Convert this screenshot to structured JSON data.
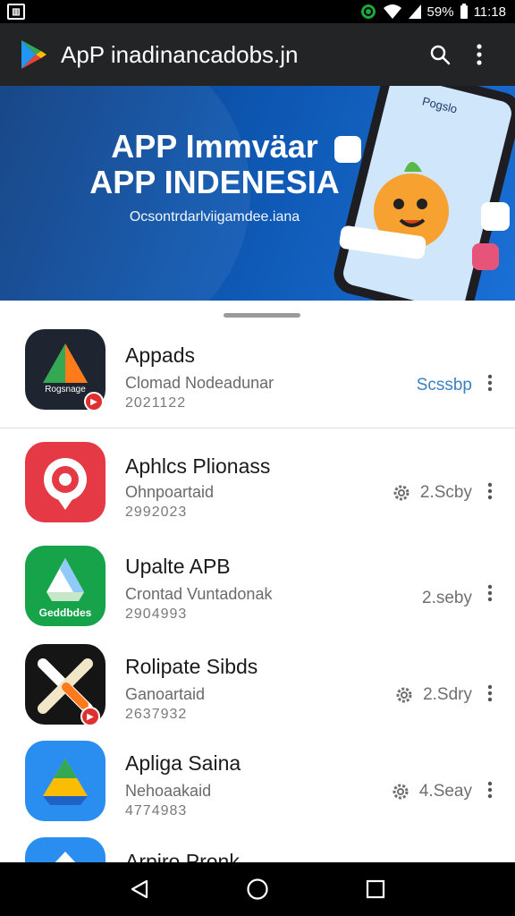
{
  "status_bar": {
    "battery": "59%",
    "time": "11:18",
    "icons": [
      "sim-card-icon",
      "vpn-icon",
      "wifi-icon",
      "signal-icon",
      "battery-icon"
    ]
  },
  "app_bar": {
    "title": "ApP inadinancadobs.jn",
    "logo_icon": "play-logo-icon",
    "actions": [
      "search-icon",
      "more-vert-icon"
    ]
  },
  "banner": {
    "headline_1": "APP Immväar",
    "headline_2": "APP INDENESIA",
    "subtitle": "Ocsontrdarlviigamdee.iana",
    "phone_label": "Pogslo",
    "carousel_dots": 3,
    "active_dot": 2
  },
  "apps": [
    {
      "name": "Appads",
      "developer": "Clomad Nodeadunar",
      "date": "2021122",
      "status": "Scssbp",
      "status_type": "link",
      "icon_label": "Rogsnage",
      "icon_bg": "#1f2530",
      "has_badge": true
    },
    {
      "name": "Aphlcs Plionass",
      "developer": "Ohnpoartaid",
      "date": "2992023",
      "status": "2.Scby",
      "status_type": "settings",
      "icon_label": "",
      "icon_bg": "#e63946",
      "has_badge": false
    },
    {
      "name": "Upalte APB",
      "developer": "Crontad Vuntadonak",
      "date": "2904993",
      "status": "2.seby",
      "status_type": "plain",
      "icon_label": "Geddbdes",
      "icon_bg": "#16a34a",
      "has_badge": false
    },
    {
      "name": "Rolipate Sibds",
      "developer": "Ganoartaid",
      "date": "2637932",
      "status": "2.Sdry",
      "status_type": "settings",
      "icon_label": "",
      "icon_bg": "#151515",
      "has_badge": true
    },
    {
      "name": "Apliga Saina",
      "developer": "Nehoaakaid",
      "date": "4774983",
      "status": "4.Seay",
      "status_type": "settings",
      "icon_label": "",
      "icon_bg": "#2a8ef0",
      "has_badge": false
    },
    {
      "name": "Arpiro Pronk",
      "developer": "",
      "date": "",
      "status": "",
      "status_type": "plain",
      "icon_label": "",
      "icon_bg": "#2a8ef0",
      "has_badge": false
    }
  ],
  "nav_bar": {
    "buttons": [
      "back-icon",
      "home-icon",
      "recents-icon"
    ]
  },
  "colors": {
    "app_bar_bg": "#222426",
    "banner_bg": "#0d56b0",
    "link": "#3b82c4",
    "nav_bg": "#000000"
  }
}
